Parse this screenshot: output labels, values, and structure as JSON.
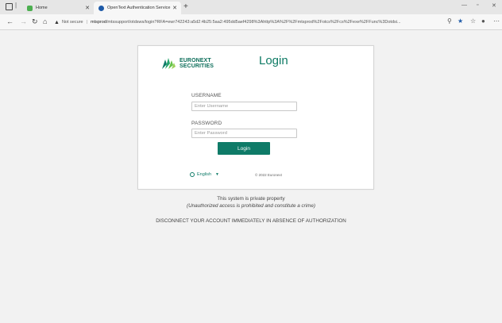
{
  "browser": {
    "tabs": [
      {
        "label": "Home",
        "active": false,
        "favicon": "home-favicon"
      },
      {
        "label": "OpenText Authentication Service",
        "active": true,
        "favicon": "auth-favicon"
      }
    ],
    "new_tab_label": "+",
    "address": {
      "security_label": "Not secure",
      "url_host": "mtsprod",
      "url_path": "/mtssupport/otdsws/login?RFA=ewr742243:a5d2:4b25:5aa2:495dd5aef4298%3Ahttp%3A%2F%2Fmtsprod%2Fotcs%2Fcs%2Fexe%2FFunc%3Dotdsi..."
    },
    "accent_color": "#1e5aa8"
  },
  "login": {
    "brand_line1": "EURONEXT",
    "brand_line2": "SECURITIES",
    "title": "Login",
    "username_label": "USERNAME",
    "username_placeholder": "Enter Username",
    "password_label": "PASSWORD",
    "password_placeholder": "Enter Password",
    "submit_label": "Login",
    "language": "English",
    "copyright": "© 2022 Euronext",
    "brand_color": "#0f7b68"
  },
  "notices": {
    "line1": "This system is private property",
    "line2": "(Unauthorized access is prohibited and constitute a crime)",
    "line3": "DISCONNECT YOUR ACCOUNT IMMEDIATELY IN ABSENCE OF AUTHORIZATION"
  }
}
